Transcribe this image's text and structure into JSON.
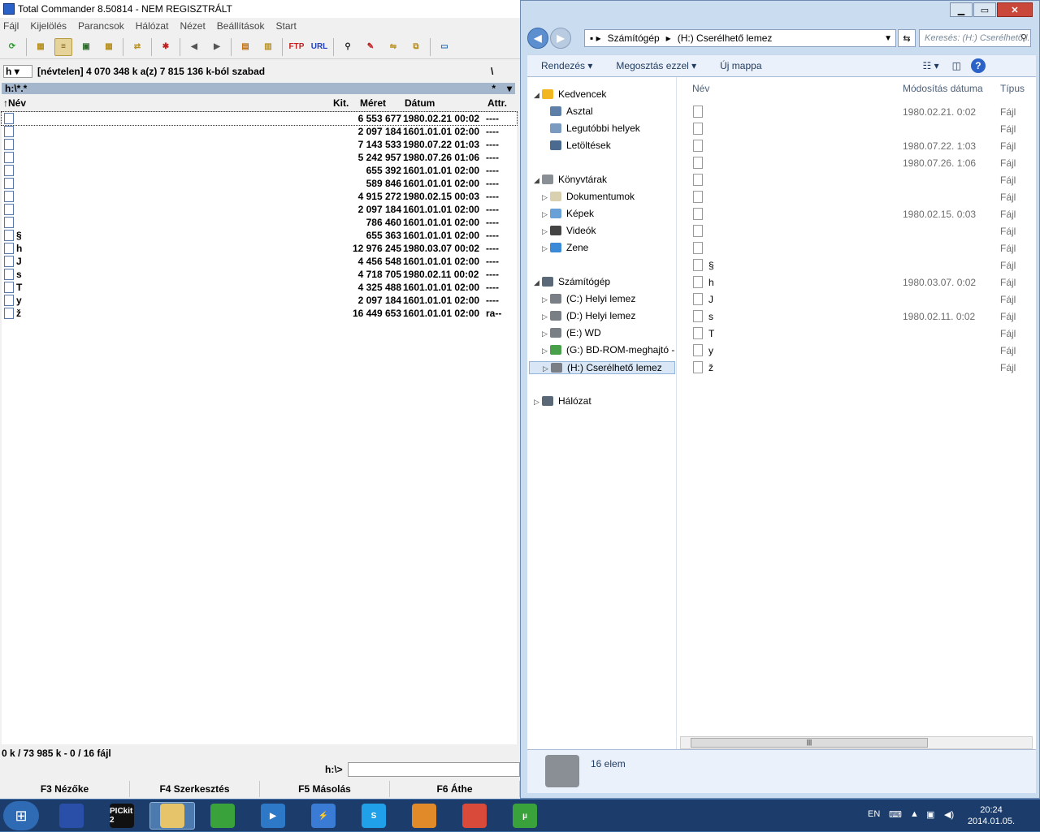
{
  "tc": {
    "title": "Total Commander 8.50814 - NEM REGISZTRÁLT",
    "menu": [
      "Fájl",
      "Kijelölés",
      "Parancsok",
      "Hálózat",
      "Nézet",
      "Beállítások",
      "Start"
    ],
    "drive_letter": "h",
    "drive_info": "[névtelen]  4 070 348 k a(z) 7 815 136 k-ból szabad",
    "root_btn": "\\",
    "path": "h:\\*.*",
    "filter": "*",
    "columns": {
      "name": "Név",
      "ext": "Kit.",
      "size": "Méret",
      "date": "Dátum",
      "attr": "Attr."
    },
    "files": [
      {
        "name": "",
        "size": "6 553 677",
        "date": "1980.02.21 00:02",
        "attr": "----"
      },
      {
        "name": "",
        "size": "2 097 184",
        "date": "1601.01.01 02:00",
        "attr": "----"
      },
      {
        "name": "",
        "size": "7 143 533",
        "date": "1980.07.22 01:03",
        "attr": "----"
      },
      {
        "name": "",
        "size": "5 242 957",
        "date": "1980.07.26 01:06",
        "attr": "----"
      },
      {
        "name": "",
        "size": "655 392",
        "date": "1601.01.01 02:00",
        "attr": "----"
      },
      {
        "name": "",
        "size": "589 846",
        "date": "1601.01.01 02:00",
        "attr": "----"
      },
      {
        "name": "",
        "size": "4 915 272",
        "date": "1980.02.15 00:03",
        "attr": "----"
      },
      {
        "name": "",
        "size": "2 097 184",
        "date": "1601.01.01 02:00",
        "attr": "----"
      },
      {
        "name": "",
        "size": "786 460",
        "date": "1601.01.01 02:00",
        "attr": "----"
      },
      {
        "name": "§",
        "size": "655 363",
        "date": "1601.01.01 02:00",
        "attr": "----"
      },
      {
        "name": "h",
        "size": "12 976 245",
        "date": "1980.03.07 00:02",
        "attr": "----"
      },
      {
        "name": "J",
        "size": "4 456 548",
        "date": "1601.01.01 02:00",
        "attr": "----"
      },
      {
        "name": "s",
        "size": "4 718 705",
        "date": "1980.02.11 00:02",
        "attr": "----"
      },
      {
        "name": "T",
        "size": "4 325 488",
        "date": "1601.01.01 02:00",
        "attr": "----"
      },
      {
        "name": "y",
        "size": "2 097 184",
        "date": "1601.01.01 02:00",
        "attr": "----"
      },
      {
        "name": "ž",
        "size": "16 449 653",
        "date": "1601.01.01 02:00",
        "attr": "ra--"
      }
    ],
    "status": "0 k / 73 985 k - 0 / 16 fájl",
    "cmd_label": "h:\\>",
    "fkeys": [
      "F3 Nézőke",
      "F4 Szerkesztés",
      "F5 Másolás",
      "F6 Áthe"
    ]
  },
  "ex": {
    "address": [
      "Számítógép",
      "(H:) Cserélhető lemez"
    ],
    "search_placeholder": "Keresés: (H:) Cserélhető l...",
    "cmds": [
      "Rendezés ▾",
      "Megosztás ezzel ▾",
      "Új mappa"
    ],
    "nav": [
      {
        "label": "Kedvencek",
        "icon": "star-icon",
        "color": "#f2b720"
      },
      {
        "label": "Asztal",
        "icon": "desktop-icon",
        "color": "#5d7fa8"
      },
      {
        "label": "Legutóbbi helyek",
        "icon": "recent-places-icon",
        "color": "#7a9ac0"
      },
      {
        "label": "Letöltések",
        "icon": "downloads-icon",
        "color": "#4a6a8f"
      },
      {
        "label": "Könyvtárak",
        "icon": "libraries-icon",
        "color": "#8a8f96"
      },
      {
        "label": "Dokumentumok",
        "icon": "documents-icon",
        "color": "#d9d0b0"
      },
      {
        "label": "Képek",
        "icon": "pictures-icon",
        "color": "#6aa0d8"
      },
      {
        "label": "Videók",
        "icon": "videos-icon",
        "color": "#444"
      },
      {
        "label": "Zene",
        "icon": "music-icon",
        "color": "#3a8ad8"
      },
      {
        "label": "Számítógép",
        "icon": "computer-icon",
        "color": "#5a6878"
      },
      {
        "label": "(C:) Helyi lemez",
        "icon": "drive-icon",
        "color": "#7a7f86"
      },
      {
        "label": "(D:) Helyi lemez",
        "icon": "drive-icon",
        "color": "#7a7f86"
      },
      {
        "label": "(E:) WD",
        "icon": "drive-icon",
        "color": "#7a7f86"
      },
      {
        "label": "(G:) BD-ROM-meghajtó -",
        "icon": "bd-rom-icon",
        "color": "#48a04a"
      },
      {
        "label": "(H:) Cserélhető lemez",
        "icon": "removable-drive-icon",
        "color": "#7a7f86"
      },
      {
        "label": "Hálózat",
        "icon": "network-icon",
        "color": "#5a6878"
      }
    ],
    "columns": {
      "name": "Név",
      "date": "Módosítás dátuma",
      "type": "Típus"
    },
    "files": [
      {
        "name": "",
        "date": "1980.02.21. 0:02",
        "type": "Fájl"
      },
      {
        "name": "",
        "date": "",
        "type": "Fájl"
      },
      {
        "name": "",
        "date": "1980.07.22. 1:03",
        "type": "Fájl"
      },
      {
        "name": "",
        "date": "1980.07.26. 1:06",
        "type": "Fájl"
      },
      {
        "name": "",
        "date": "",
        "type": "Fájl"
      },
      {
        "name": "",
        "date": "",
        "type": "Fájl"
      },
      {
        "name": "",
        "date": "1980.02.15. 0:03",
        "type": "Fájl"
      },
      {
        "name": "",
        "date": "",
        "type": "Fájl"
      },
      {
        "name": "",
        "date": "",
        "type": "Fájl"
      },
      {
        "name": "§",
        "date": "",
        "type": "Fájl"
      },
      {
        "name": "h",
        "date": "1980.03.07. 0:02",
        "type": "Fájl"
      },
      {
        "name": "J",
        "date": "",
        "type": "Fájl"
      },
      {
        "name": "s",
        "date": "1980.02.11. 0:02",
        "type": "Fájl"
      },
      {
        "name": "T",
        "date": "",
        "type": "Fájl"
      },
      {
        "name": "y",
        "date": "",
        "type": "Fájl"
      },
      {
        "name": "ž",
        "date": "",
        "type": "Fájl"
      }
    ],
    "details": "16 elem"
  },
  "taskbar": {
    "apps": [
      {
        "name": "save-app",
        "label": "",
        "color": "#2a4fa8"
      },
      {
        "name": "pickit2-app",
        "label": "PICkit 2",
        "color": "#111"
      },
      {
        "name": "explorer-app",
        "label": "",
        "color": "#e6c46a"
      },
      {
        "name": "green-app",
        "label": "",
        "color": "#3aa23a"
      },
      {
        "name": "media-player-app",
        "label": "▶",
        "color": "#2e78c8"
      },
      {
        "name": "lightning-app",
        "label": "⚡",
        "color": "#3a7bd5"
      },
      {
        "name": "skype-app",
        "label": "S",
        "color": "#1fa0e8"
      },
      {
        "name": "media-app",
        "label": "",
        "color": "#e08a2a"
      },
      {
        "name": "chrome-app",
        "label": "",
        "color": "#d94a3a"
      },
      {
        "name": "utorrent-app",
        "label": "µ",
        "color": "#3aa23a"
      }
    ],
    "lang": "EN",
    "time": "20:24",
    "date": "2014.01.05."
  }
}
